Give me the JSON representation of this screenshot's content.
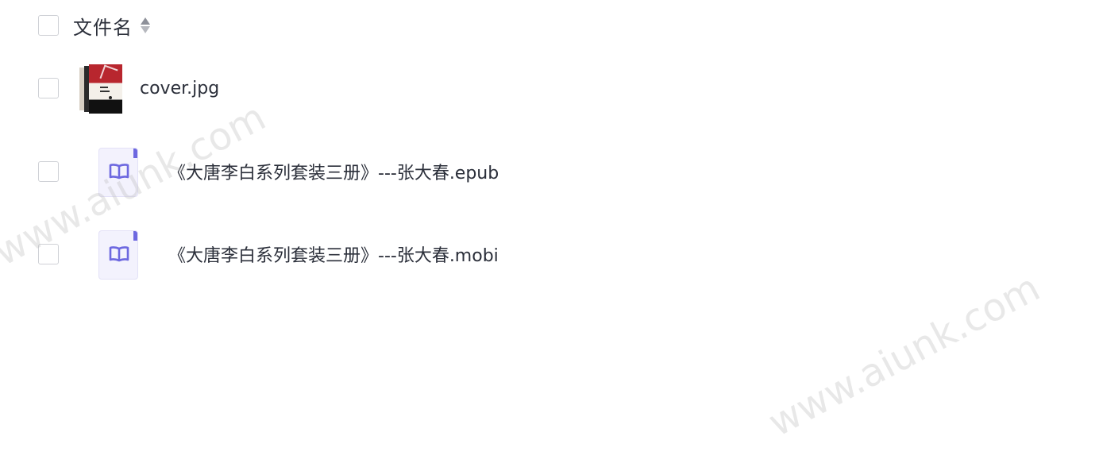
{
  "header": {
    "title": "文件名",
    "sort_icon": "sort-toggle-icon"
  },
  "files": [
    {
      "name": "cover.jpg",
      "icon": "image-thumbnail"
    },
    {
      "name": "《大唐李白系列套装三册》---张大春.epub",
      "icon": "ebook-icon"
    },
    {
      "name": "《大唐李白系列套装三册》---张大春.mobi",
      "icon": "ebook-icon"
    }
  ],
  "watermark": {
    "text": "www.aiunk.com"
  },
  "colors": {
    "ebook_accent": "#6d68e0",
    "ebook_bg": "#f3f2fd",
    "checkbox_border": "#cfd1d6"
  }
}
